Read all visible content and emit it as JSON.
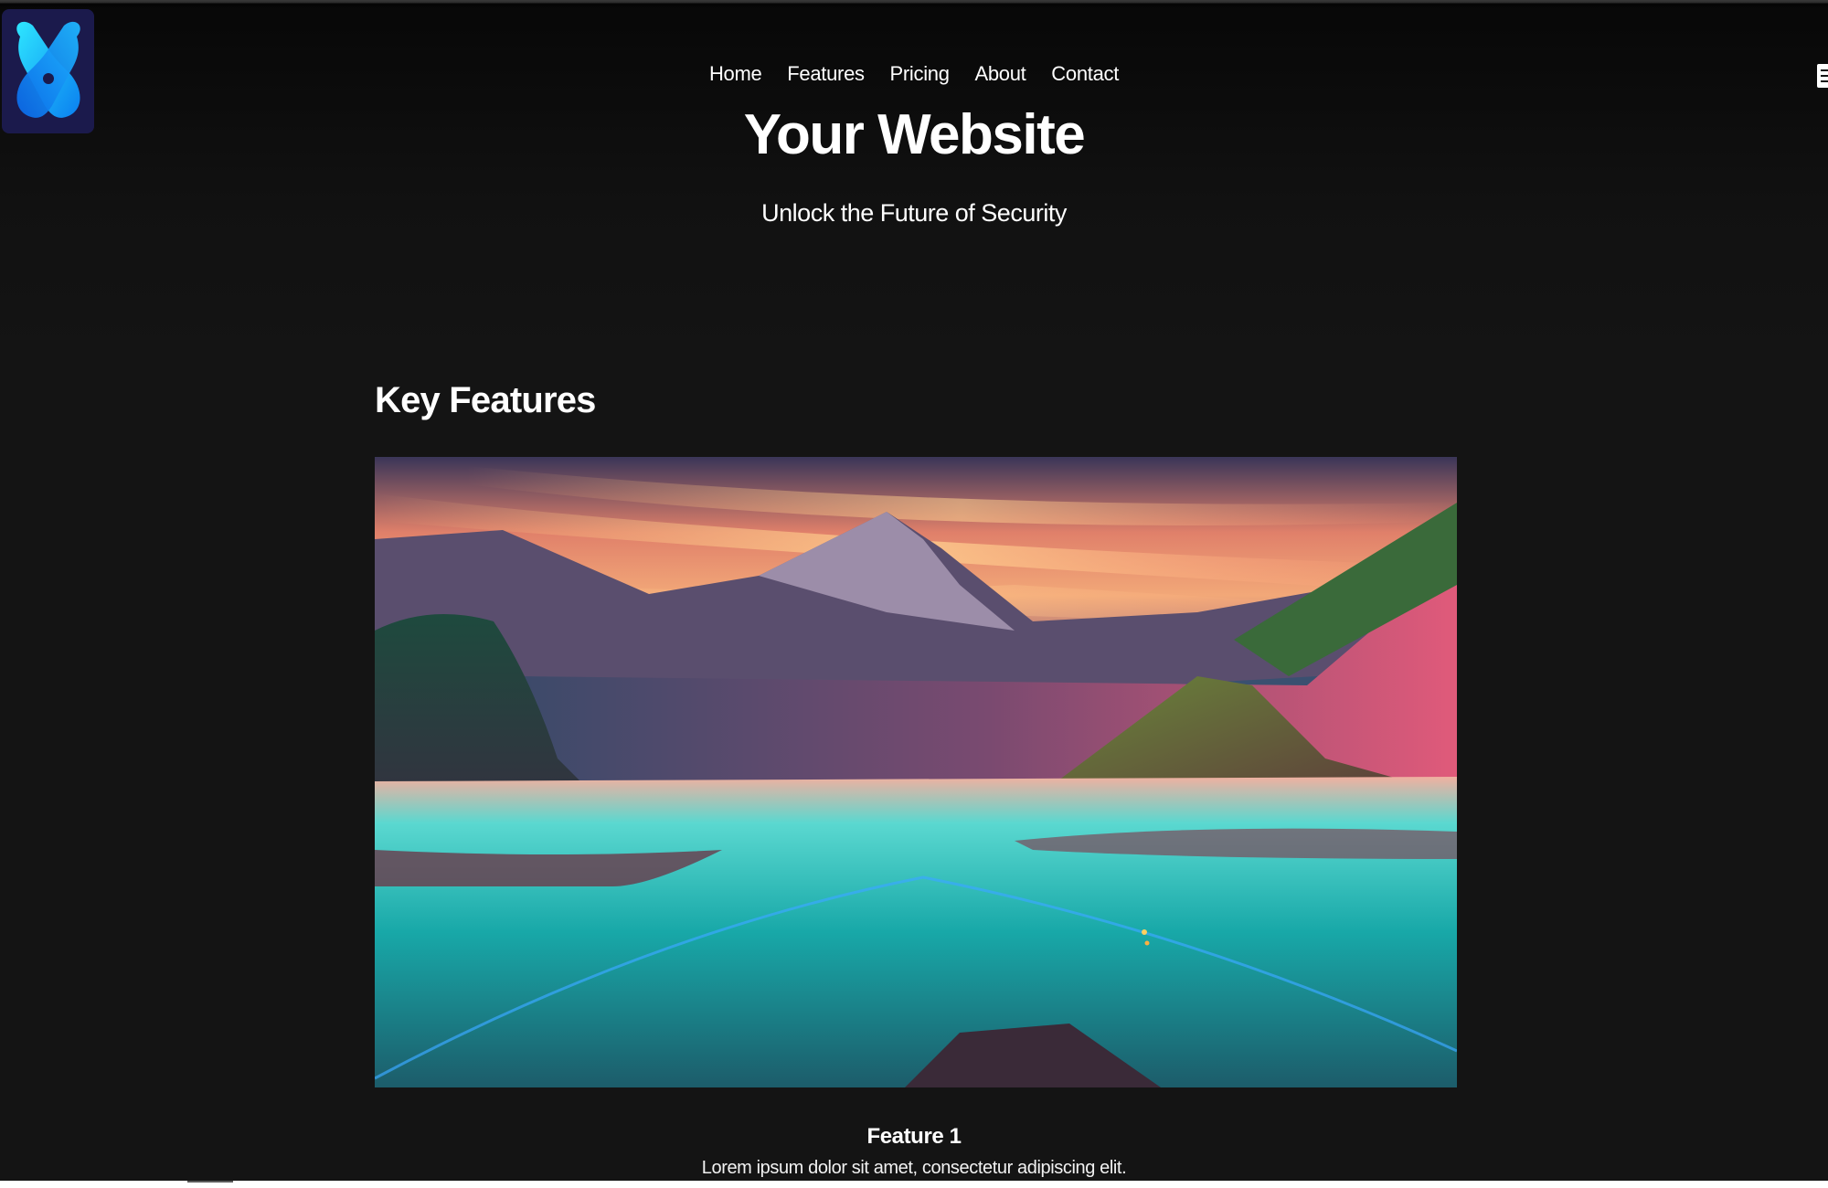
{
  "nav": {
    "items": [
      {
        "label": "Home"
      },
      {
        "label": "Features"
      },
      {
        "label": "Pricing"
      },
      {
        "label": "About"
      },
      {
        "label": "Contact"
      }
    ]
  },
  "logo": {
    "icon": "x-logo-icon",
    "colors": [
      "#1b1a4c",
      "#0aa6f2",
      "#2dd6ff"
    ]
  },
  "menu": {
    "icon": "hamburger-menu-icon"
  },
  "header": {
    "title": "Your Website",
    "tagline": "Unlock the Future of Security"
  },
  "features": {
    "heading": "Key Features",
    "items": [
      {
        "title": "Feature 1",
        "description": "Lorem ipsum dolor sit amet, consectetur adipiscing elit.",
        "image": "mountain-lake-landscape-image"
      }
    ]
  },
  "colors": {
    "background": "#141414",
    "text": "#ffffff"
  }
}
